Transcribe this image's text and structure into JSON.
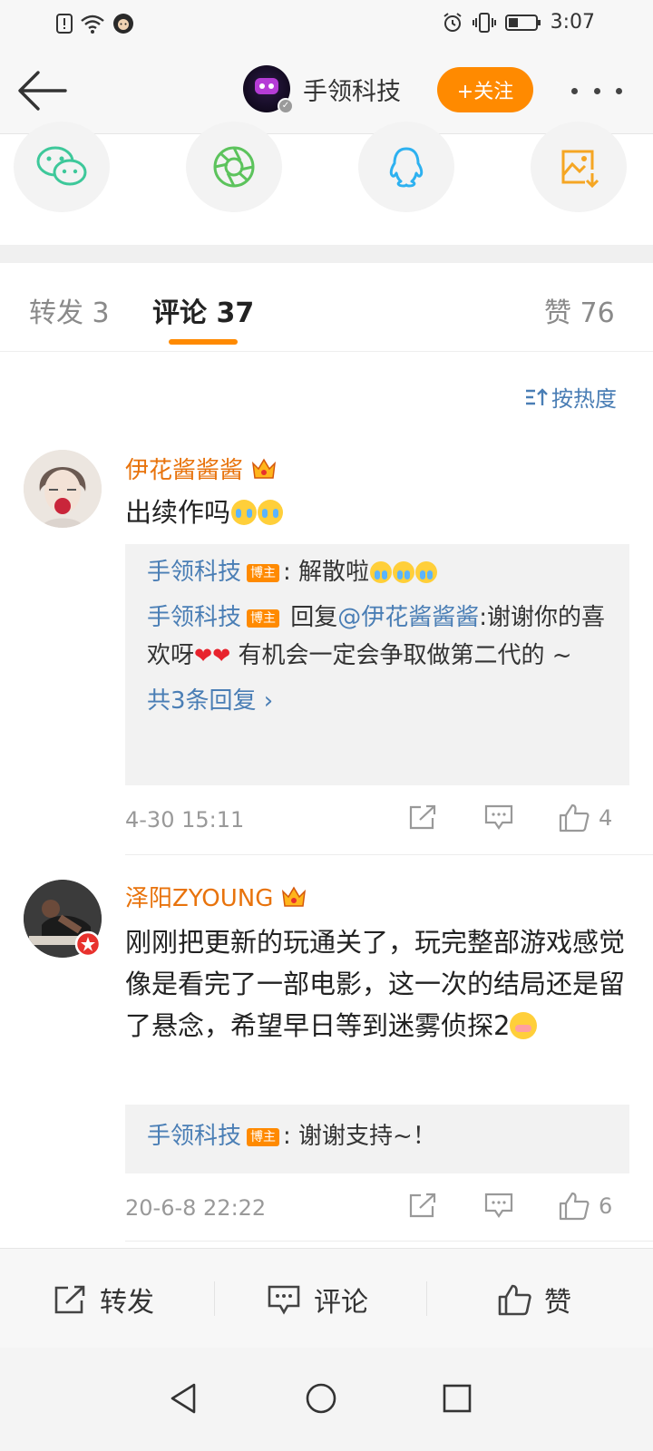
{
  "status_bar": {
    "time": "3:07"
  },
  "header": {
    "account_name": "手领科技",
    "follow_label": "+关注"
  },
  "tabs": [
    {
      "label": "转发 3"
    },
    {
      "label": "评论 37"
    },
    {
      "label": "赞 76"
    }
  ],
  "sort_label": "按热度",
  "comments": [
    {
      "username": "伊花酱酱酱",
      "text": "出续作吗",
      "replies": [
        {
          "name": "手领科技",
          "tag": "博主",
          "text": ": 解散啦"
        },
        {
          "name": "手领科技",
          "tag": "博主",
          "prefix": " 回复",
          "mention": "@伊花酱酱酱",
          "text_1": ":谢谢你的喜欢呀",
          "text_2": " 有机会一定会争取做第二代的 ~"
        }
      ],
      "more_replies": "共3条回复 ›",
      "time": "4-30 15:11",
      "like_count": "4"
    },
    {
      "username": "泽阳ZYOUNG",
      "text": "刚刚把更新的玩通关了，玩完整部游戏感觉像是看完了一部电影，这一次的结局还是留了悬念，希望早日等到迷雾侦探2",
      "replies": [
        {
          "name": "手领科技",
          "tag": "博主",
          "text": ": 谢谢支持~！"
        }
      ],
      "time": "20-6-8 22:22",
      "like_count": "6"
    }
  ],
  "bottom_bar": {
    "repost": "转发",
    "comment": "评论",
    "like": "赞"
  },
  "colors": {
    "accent": "#ff8a00",
    "username": "#e8730c",
    "link": "#4a7eb5"
  }
}
